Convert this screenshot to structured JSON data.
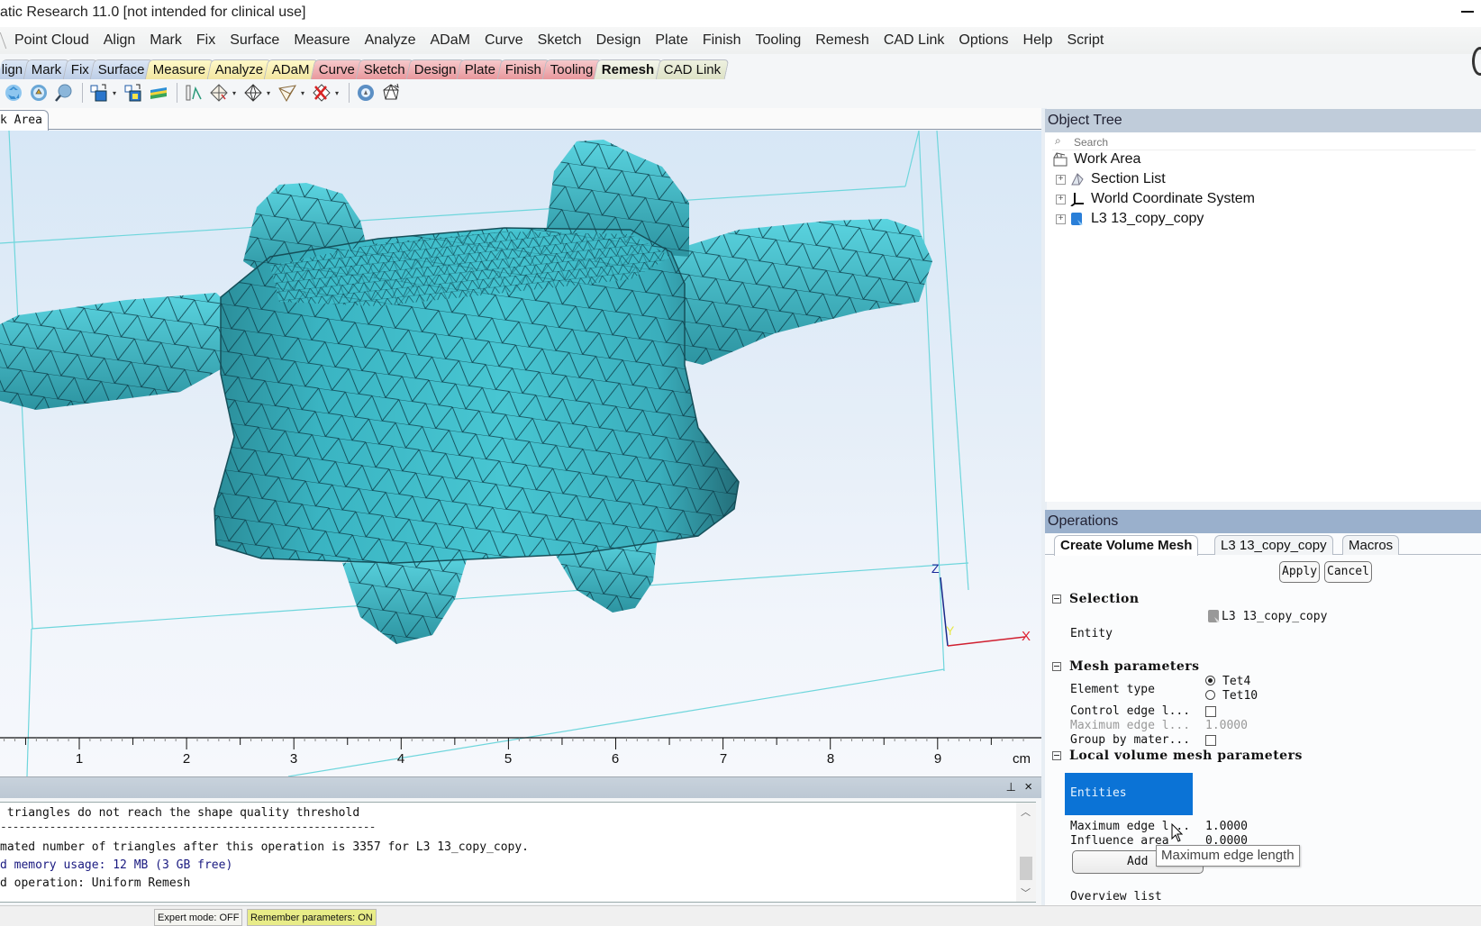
{
  "window": {
    "title": "atic Research 11.0  [not intended for clinical use]"
  },
  "menu": {
    "items": [
      "Point Cloud",
      "Align",
      "Mark",
      "Fix",
      "Surface",
      "Measure",
      "Analyze",
      "ADaM",
      "Curve",
      "Sketch",
      "Design",
      "Plate",
      "Finish",
      "Tooling",
      "Remesh",
      "CAD Link",
      "Options",
      "Help",
      "Script"
    ]
  },
  "ribbon": {
    "tabs": [
      {
        "label": "lign",
        "color": "blue"
      },
      {
        "label": "Mark",
        "color": "blue"
      },
      {
        "label": "Fix",
        "color": "blue"
      },
      {
        "label": "Surface",
        "color": "blue"
      },
      {
        "label": "Measure",
        "color": "yellow"
      },
      {
        "label": "Analyze",
        "color": "yellow"
      },
      {
        "label": "ADaM",
        "color": "yellow"
      },
      {
        "label": "Curve",
        "color": "red"
      },
      {
        "label": "Sketch",
        "color": "red"
      },
      {
        "label": "Design",
        "color": "red"
      },
      {
        "label": "Plate",
        "color": "red"
      },
      {
        "label": "Finish",
        "color": "red"
      },
      {
        "label": "Tooling",
        "color": "red"
      },
      {
        "label": "Remesh",
        "color": "green",
        "active": true
      },
      {
        "label": "CAD Link",
        "color": "green"
      }
    ]
  },
  "toolbar": {
    "icons": [
      "remesh-recycle-icon",
      "smooth-sphere-icon",
      "inspect-magnifier-icon",
      "reduce-blocks-icon",
      "refine-blocks-icon",
      "layers-icon",
      "measure-edge-icon",
      "quality-preserving-icon",
      "tet-mesh-icon",
      "flip-edge-icon",
      "remove-triangle-icon",
      "volume-mesh-icon",
      "create-volume-mesh-icon"
    ]
  },
  "workarea": {
    "tab_label": "k Area",
    "ruler": {
      "ticks": [
        "1",
        "2",
        "3",
        "4",
        "5",
        "6",
        "7",
        "8",
        "9"
      ],
      "unit": "cm"
    },
    "axes": {
      "z": "Z",
      "y": "Y",
      "x": "X"
    },
    "mesh_color": "#3fbfcc"
  },
  "log": {
    "lines": [
      {
        "text": " triangles do not reach the shape quality threshold",
        "style": "normal"
      },
      {
        "text": "-------------------------------------------------------------",
        "style": "dashes"
      },
      {
        "text": "mated number of triangles after this operation is 3357 for L3 13_copy_copy.",
        "style": "normal"
      },
      {
        "text": "d memory usage: 12 MB (3 GB free)",
        "style": "blue"
      },
      {
        "text": "d operation: Uniform Remesh",
        "style": "normal"
      }
    ]
  },
  "statusbar": {
    "expert_mode": "Expert mode: OFF",
    "remember_params": "Remember parameters: ON"
  },
  "object_tree": {
    "title": "Object Tree",
    "search_placeholder": "Search",
    "nodes": [
      {
        "label": "Work Area",
        "icon": "work-area-icon"
      },
      {
        "label": "Section List",
        "icon": "section-list-icon"
      },
      {
        "label": "World Coordinate System",
        "icon": "coordinate-system-icon"
      },
      {
        "label": "L3 13_copy_copy",
        "icon": "mesh-object-icon"
      }
    ]
  },
  "operations": {
    "title": "Operations",
    "tabs": [
      "Create Volume Mesh",
      "L3 13_copy_copy",
      "Macros"
    ],
    "apply": "Apply",
    "cancel": "Cancel",
    "selection": {
      "header": "Selection",
      "entity_label": "Entity",
      "entity_value": "L3 13_copy_copy"
    },
    "mesh_params": {
      "header": "Mesh parameters",
      "element_type_label": "Element type",
      "element_types": [
        "Tet4",
        "Tet10"
      ],
      "selected_element_type": "Tet4",
      "control_edge_label": "Control edge l...",
      "control_edge_checked": false,
      "max_edge_label": "Maximum edge l...",
      "max_edge_value": "1.0000",
      "group_by_material_label": "Group by mater...",
      "group_by_material_checked": false
    },
    "local_params": {
      "header": "Local volume mesh parameters",
      "entities_label": "Entities",
      "max_edge_label": "Maximum edge l...",
      "max_edge_value": "1.0000",
      "influence_label": "Influence area",
      "influence_value": "0.0000",
      "add_label": "Add",
      "overview_label": "Overview list"
    },
    "tooltip": "Maximum edge length"
  }
}
